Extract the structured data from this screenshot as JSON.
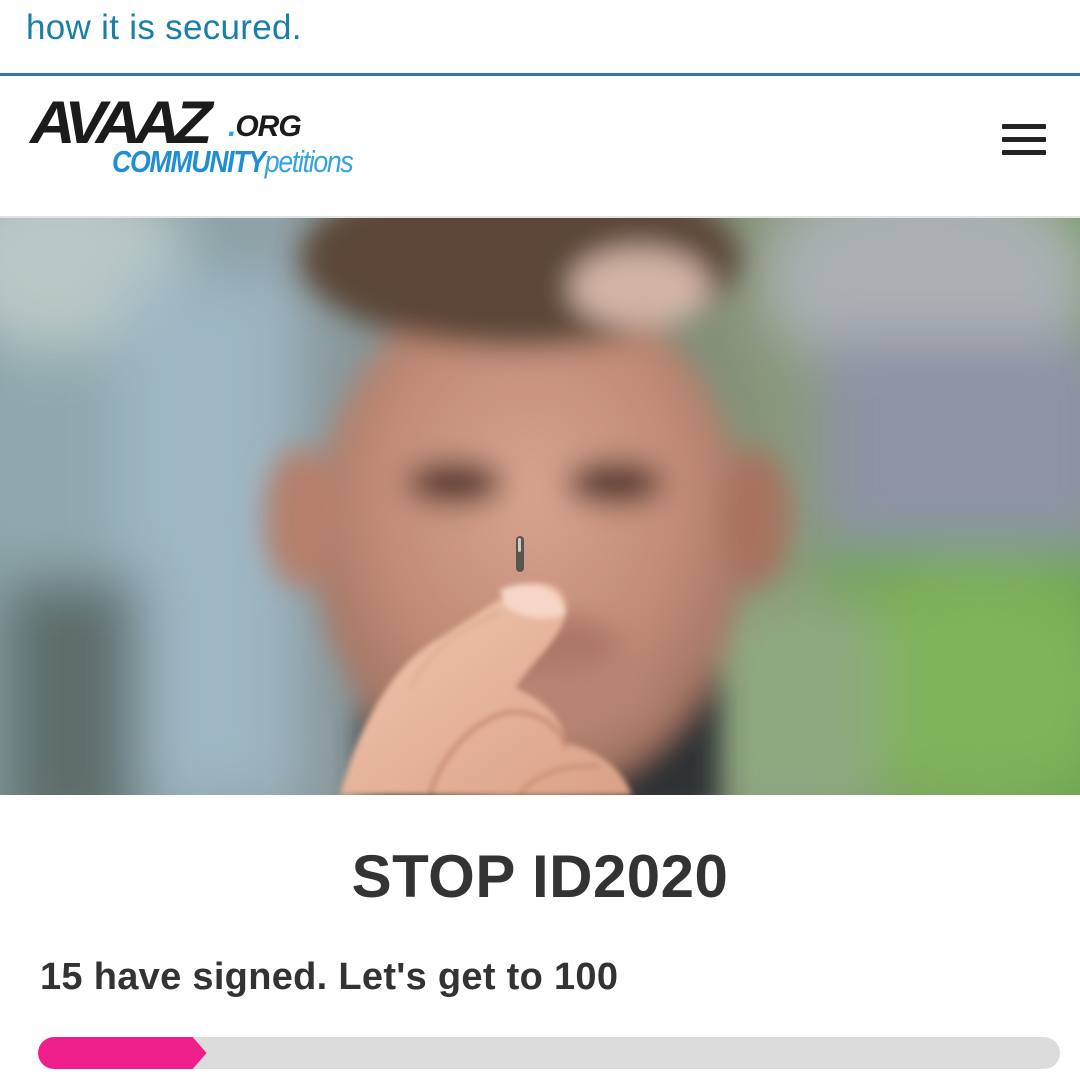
{
  "banner": {
    "text": "how it is secured."
  },
  "header": {
    "logo_main": "AVAAZ",
    "logo_dot": ".",
    "logo_org": "ORG",
    "logo_community": "COMMUNITY",
    "logo_petitions": "petitions",
    "menu_icon": "hamburger-menu-icon"
  },
  "hero": {
    "image": "blurred-man-holding-microchip-photo"
  },
  "petition": {
    "title": "STOP ID2020",
    "signed_text": "15 have signed. Let's get to 100",
    "signed_count": 15,
    "goal": 100,
    "progress_fraction": 0.165
  },
  "colors": {
    "banner_text": "#1a7fa6",
    "divider": "#2a7fa8",
    "brand_blue": "#1e8fd4",
    "progress_fill": "#ee1f8a",
    "progress_track": "#dcdcdc",
    "title_text": "#333333"
  }
}
